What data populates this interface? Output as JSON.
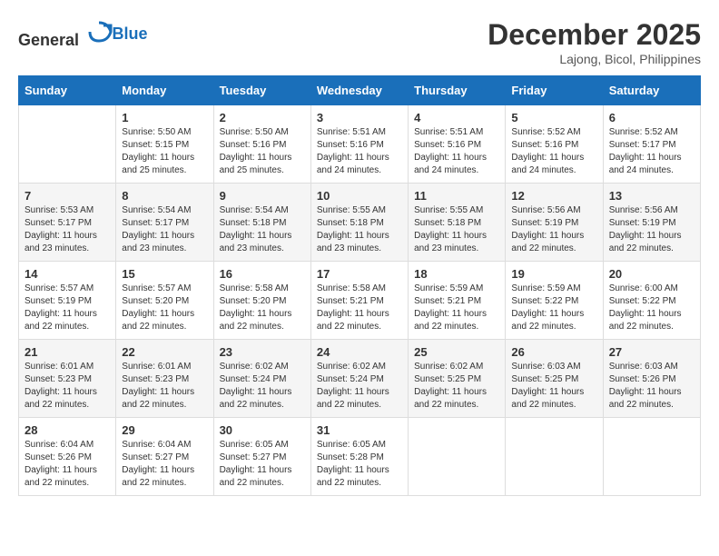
{
  "logo": {
    "general": "General",
    "blue": "Blue"
  },
  "title": {
    "month_year": "December 2025",
    "location": "Lajong, Bicol, Philippines"
  },
  "days_of_week": [
    "Sunday",
    "Monday",
    "Tuesday",
    "Wednesday",
    "Thursday",
    "Friday",
    "Saturday"
  ],
  "weeks": [
    [
      {
        "day": "",
        "info": ""
      },
      {
        "day": "1",
        "info": "Sunrise: 5:50 AM\nSunset: 5:15 PM\nDaylight: 11 hours and 25 minutes."
      },
      {
        "day": "2",
        "info": "Sunrise: 5:50 AM\nSunset: 5:16 PM\nDaylight: 11 hours and 25 minutes."
      },
      {
        "day": "3",
        "info": "Sunrise: 5:51 AM\nSunset: 5:16 PM\nDaylight: 11 hours and 24 minutes."
      },
      {
        "day": "4",
        "info": "Sunrise: 5:51 AM\nSunset: 5:16 PM\nDaylight: 11 hours and 24 minutes."
      },
      {
        "day": "5",
        "info": "Sunrise: 5:52 AM\nSunset: 5:16 PM\nDaylight: 11 hours and 24 minutes."
      },
      {
        "day": "6",
        "info": "Sunrise: 5:52 AM\nSunset: 5:17 PM\nDaylight: 11 hours and 24 minutes."
      }
    ],
    [
      {
        "day": "7",
        "info": "Sunrise: 5:53 AM\nSunset: 5:17 PM\nDaylight: 11 hours and 23 minutes."
      },
      {
        "day": "8",
        "info": "Sunrise: 5:54 AM\nSunset: 5:17 PM\nDaylight: 11 hours and 23 minutes."
      },
      {
        "day": "9",
        "info": "Sunrise: 5:54 AM\nSunset: 5:18 PM\nDaylight: 11 hours and 23 minutes."
      },
      {
        "day": "10",
        "info": "Sunrise: 5:55 AM\nSunset: 5:18 PM\nDaylight: 11 hours and 23 minutes."
      },
      {
        "day": "11",
        "info": "Sunrise: 5:55 AM\nSunset: 5:18 PM\nDaylight: 11 hours and 23 minutes."
      },
      {
        "day": "12",
        "info": "Sunrise: 5:56 AM\nSunset: 5:19 PM\nDaylight: 11 hours and 22 minutes."
      },
      {
        "day": "13",
        "info": "Sunrise: 5:56 AM\nSunset: 5:19 PM\nDaylight: 11 hours and 22 minutes."
      }
    ],
    [
      {
        "day": "14",
        "info": "Sunrise: 5:57 AM\nSunset: 5:19 PM\nDaylight: 11 hours and 22 minutes."
      },
      {
        "day": "15",
        "info": "Sunrise: 5:57 AM\nSunset: 5:20 PM\nDaylight: 11 hours and 22 minutes."
      },
      {
        "day": "16",
        "info": "Sunrise: 5:58 AM\nSunset: 5:20 PM\nDaylight: 11 hours and 22 minutes."
      },
      {
        "day": "17",
        "info": "Sunrise: 5:58 AM\nSunset: 5:21 PM\nDaylight: 11 hours and 22 minutes."
      },
      {
        "day": "18",
        "info": "Sunrise: 5:59 AM\nSunset: 5:21 PM\nDaylight: 11 hours and 22 minutes."
      },
      {
        "day": "19",
        "info": "Sunrise: 5:59 AM\nSunset: 5:22 PM\nDaylight: 11 hours and 22 minutes."
      },
      {
        "day": "20",
        "info": "Sunrise: 6:00 AM\nSunset: 5:22 PM\nDaylight: 11 hours and 22 minutes."
      }
    ],
    [
      {
        "day": "21",
        "info": "Sunrise: 6:01 AM\nSunset: 5:23 PM\nDaylight: 11 hours and 22 minutes."
      },
      {
        "day": "22",
        "info": "Sunrise: 6:01 AM\nSunset: 5:23 PM\nDaylight: 11 hours and 22 minutes."
      },
      {
        "day": "23",
        "info": "Sunrise: 6:02 AM\nSunset: 5:24 PM\nDaylight: 11 hours and 22 minutes."
      },
      {
        "day": "24",
        "info": "Sunrise: 6:02 AM\nSunset: 5:24 PM\nDaylight: 11 hours and 22 minutes."
      },
      {
        "day": "25",
        "info": "Sunrise: 6:02 AM\nSunset: 5:25 PM\nDaylight: 11 hours and 22 minutes."
      },
      {
        "day": "26",
        "info": "Sunrise: 6:03 AM\nSunset: 5:25 PM\nDaylight: 11 hours and 22 minutes."
      },
      {
        "day": "27",
        "info": "Sunrise: 6:03 AM\nSunset: 5:26 PM\nDaylight: 11 hours and 22 minutes."
      }
    ],
    [
      {
        "day": "28",
        "info": "Sunrise: 6:04 AM\nSunset: 5:26 PM\nDaylight: 11 hours and 22 minutes."
      },
      {
        "day": "29",
        "info": "Sunrise: 6:04 AM\nSunset: 5:27 PM\nDaylight: 11 hours and 22 minutes."
      },
      {
        "day": "30",
        "info": "Sunrise: 6:05 AM\nSunset: 5:27 PM\nDaylight: 11 hours and 22 minutes."
      },
      {
        "day": "31",
        "info": "Sunrise: 6:05 AM\nSunset: 5:28 PM\nDaylight: 11 hours and 22 minutes."
      },
      {
        "day": "",
        "info": ""
      },
      {
        "day": "",
        "info": ""
      },
      {
        "day": "",
        "info": ""
      }
    ]
  ]
}
